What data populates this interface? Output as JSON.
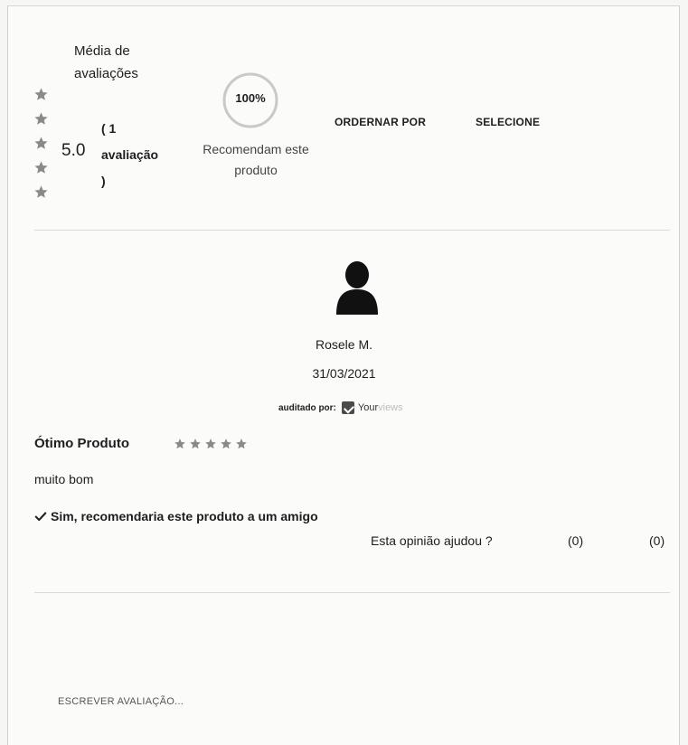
{
  "summary": {
    "average_label": "Média de avaliações",
    "average_score": "5.0",
    "rating_stars": 5,
    "count_open": "( 1",
    "count_word": "avaliação",
    "count_close": ")",
    "recommend_percent_label": "100%",
    "recommend_percent": 100,
    "recommend_text": "Recomendam este produto",
    "sort_label": "ORDERNAR POR",
    "sort_selected": "SELECIONE"
  },
  "review": {
    "author": "Rosele M.",
    "date": "31/03/2021",
    "audited_label": "auditado por:",
    "brand_your": "Your",
    "brand_views": "views",
    "title": "Ótimo Produto",
    "stars": 5,
    "body": "muito bom",
    "recommend_text": "Sim, recomendaria este produto a um amigo",
    "helpful_question": "Esta opinião ajudou ?",
    "helpful_yes": "(0)",
    "helpful_no": "(0)"
  },
  "actions": {
    "write_review": "ESCREVER AVALIAÇÃO..."
  },
  "colors": {
    "star": "#8a8a8a",
    "ring": "#c9c9c9"
  }
}
